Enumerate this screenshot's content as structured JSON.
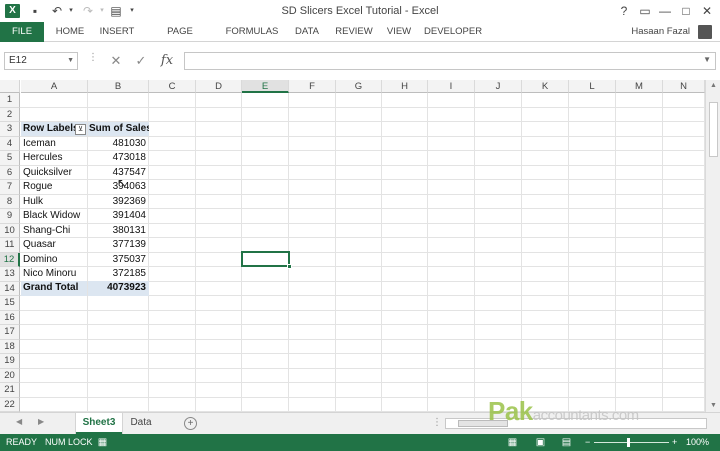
{
  "window": {
    "title": "SD Slicers Excel Tutorial - Excel",
    "help": "?",
    "restore": "▭",
    "minimize": "—",
    "maximize": "□",
    "close": "✕"
  },
  "ribbon": {
    "tabs": [
      "FILE",
      "HOME",
      "INSERT",
      "PAGE LAYOUT",
      "FORMULAS",
      "DATA",
      "REVIEW",
      "VIEW",
      "DEVELOPER"
    ],
    "user": "Hasaan Fazal"
  },
  "formula_bar": {
    "name_box": "E12",
    "cancel": "✕",
    "enter": "✓",
    "fx": "fx",
    "formula": ""
  },
  "grid": {
    "columns": [
      "A",
      "B",
      "C",
      "D",
      "E",
      "F",
      "G",
      "H",
      "I",
      "J",
      "K",
      "L",
      "M",
      "N"
    ],
    "rows": [
      "1",
      "2",
      "3",
      "4",
      "5",
      "6",
      "7",
      "8",
      "9",
      "10",
      "11",
      "12",
      "13",
      "14",
      "15",
      "16",
      "17",
      "18",
      "19",
      "20",
      "21",
      "22"
    ],
    "active_cell": "E12",
    "pivot": {
      "header_label": "Row Labels",
      "header_value": "Sum of Sales",
      "rows": [
        {
          "label": "Iceman",
          "value": "481030"
        },
        {
          "label": "Hercules",
          "value": "473018"
        },
        {
          "label": "Quicksilver",
          "value": "437547"
        },
        {
          "label": "Rogue",
          "value": "394063"
        },
        {
          "label": "Hulk",
          "value": "392369"
        },
        {
          "label": "Black Widow",
          "value": "391404"
        },
        {
          "label": "Shang-Chi",
          "value": "380131"
        },
        {
          "label": "Quasar",
          "value": "377139"
        },
        {
          "label": "Domino",
          "value": "375037"
        },
        {
          "label": "Nico Minoru",
          "value": "372185"
        }
      ],
      "total_label": "Grand Total",
      "total_value": "4073923"
    }
  },
  "sheets": {
    "tabs": [
      "Sheet3",
      "Data"
    ],
    "active": "Sheet3",
    "add": "+"
  },
  "watermark": {
    "brand": "Pak",
    "rest": "accountants.com"
  },
  "status": {
    "ready": "READY",
    "num_lock": "NUM LOCK",
    "zoom_minus": "−",
    "zoom_plus": "+",
    "zoom": "100%"
  },
  "colors": {
    "accent": "#217346",
    "pivot_header": "#dce6f1"
  }
}
